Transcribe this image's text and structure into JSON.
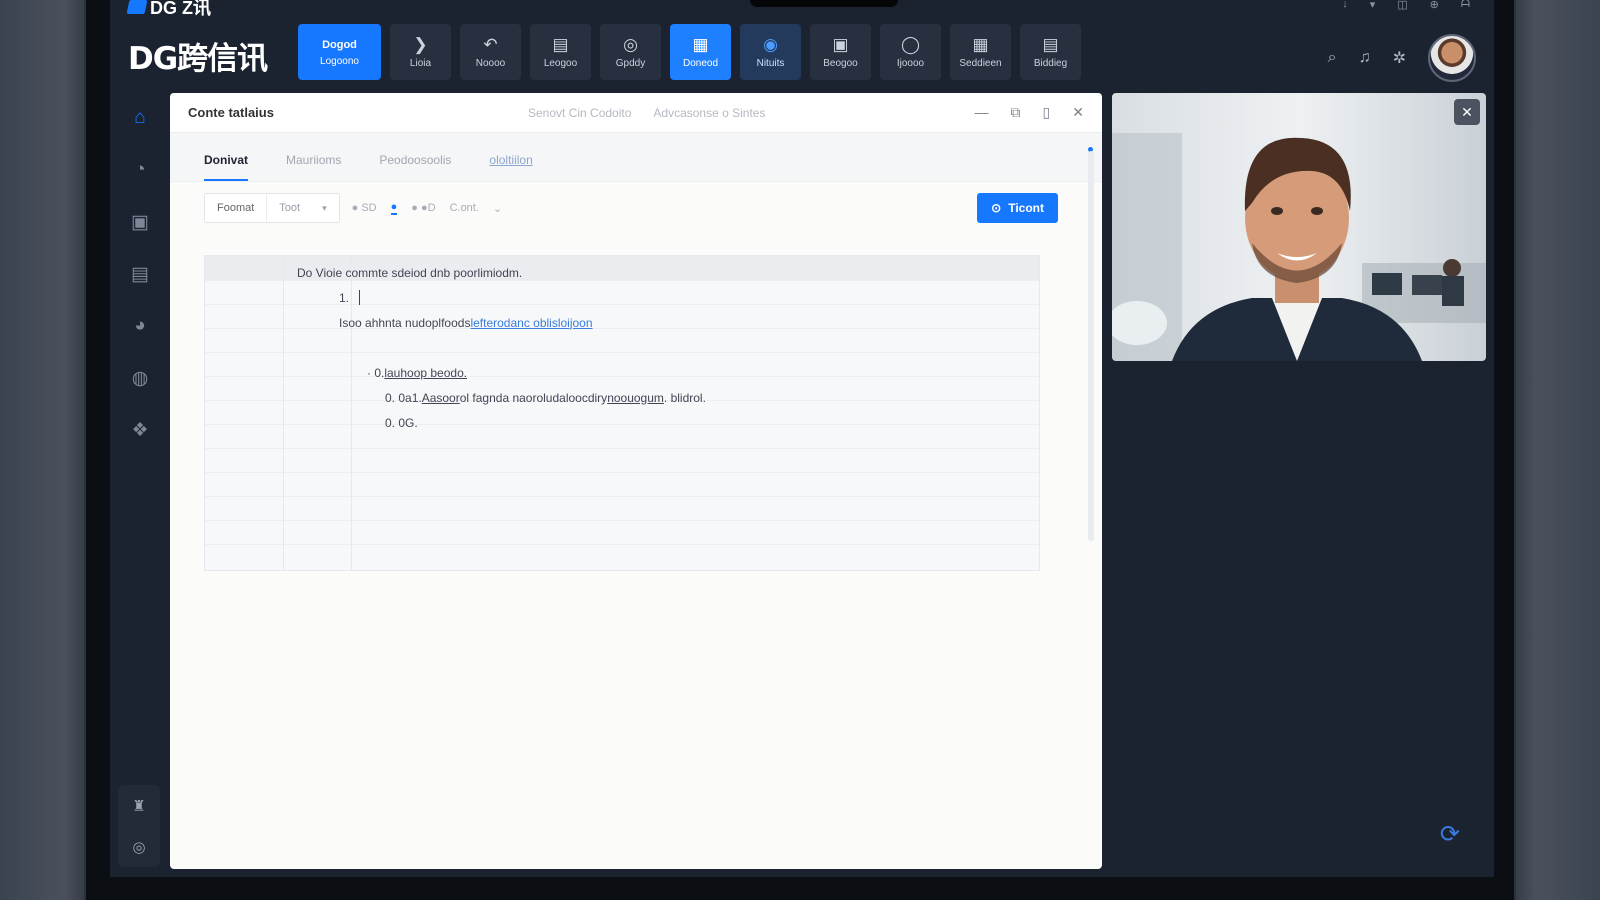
{
  "app": {
    "mini_logo_text": "DG Z讯",
    "brand": "DG跨信讯"
  },
  "toolbar": [
    {
      "label": "Logoono",
      "icon_text": "Dogod",
      "style": "primary",
      "wide": true
    },
    {
      "label": "Lioia",
      "icon": "chevron-right-icon",
      "glyph": "❯",
      "style": ""
    },
    {
      "label": "Noooo",
      "icon": "undo-icon",
      "glyph": "↶",
      "style": ""
    },
    {
      "label": "Leogoo",
      "icon": "layout-icon",
      "glyph": "▤",
      "style": ""
    },
    {
      "label": "Gpddy",
      "icon": "chat-icon",
      "glyph": "◎",
      "style": ""
    },
    {
      "label": "Doneod",
      "icon": "document-icon",
      "glyph": "▦",
      "style": "active"
    },
    {
      "label": "Nituits",
      "icon": "compass-icon",
      "glyph": "◉",
      "style": "active2"
    },
    {
      "label": "Beogoo",
      "icon": "report-icon",
      "glyph": "▣",
      "style": ""
    },
    {
      "label": "Ijoooo",
      "icon": "circle-icon",
      "glyph": "◯",
      "style": ""
    },
    {
      "label": "Seddieen",
      "icon": "calendar-icon",
      "glyph": "▦",
      "style": ""
    },
    {
      "label": "Biddieg",
      "icon": "clipboard-icon",
      "glyph": "▤",
      "style": ""
    }
  ],
  "top_right": {
    "search_glyph": "⌕",
    "bell_glyph": "♫",
    "settings_glyph": "✲"
  },
  "window": {
    "title": "Conte tatlaius",
    "subtitle_parts": [
      "Senovt Cin Codoito",
      "Advcasonse o Sintes"
    ],
    "tabs": [
      "Donivat",
      "Mauriioms",
      "Peodoosoolis",
      "ololtiilon"
    ],
    "format": {
      "select_label": "Foomat",
      "select_value": "Toot",
      "tools": [
        "● SD",
        "●",
        "● ●D",
        "C.ont."
      ],
      "submit_label": "Ticont"
    },
    "lines": [
      {
        "text": "Do   Vioie commte sdeiod dnb poorlimiodm.",
        "indent": 0
      },
      {
        "text": "1.",
        "indent": 42,
        "caret": true
      },
      {
        "prefix": "Isoo ahhnta nudoplfoods",
        "link": "lefterodanc oblisloijoon",
        "indent": 42
      },
      {
        "text": "",
        "indent": 0
      },
      {
        "prefix": "·   0.",
        "underline": "lauhoop beodo.",
        "indent": 70
      },
      {
        "prefix": "0.  0a1.",
        "underline": "Aasoor",
        "rest": " ol fagnda naoroludaloocdiry",
        "underline2": "noouogum",
        "rest2": " . blidrol.",
        "indent": 88
      },
      {
        "text": "0.  0G.",
        "indent": 88
      }
    ]
  },
  "video": {
    "close_glyph": "✕"
  },
  "sys": [
    "↓",
    "▾",
    "◫",
    "⊕",
    "ᗩ"
  ],
  "colors": {
    "accent": "#1677ff",
    "bg": "#1b2330",
    "panel": "#27303f"
  }
}
